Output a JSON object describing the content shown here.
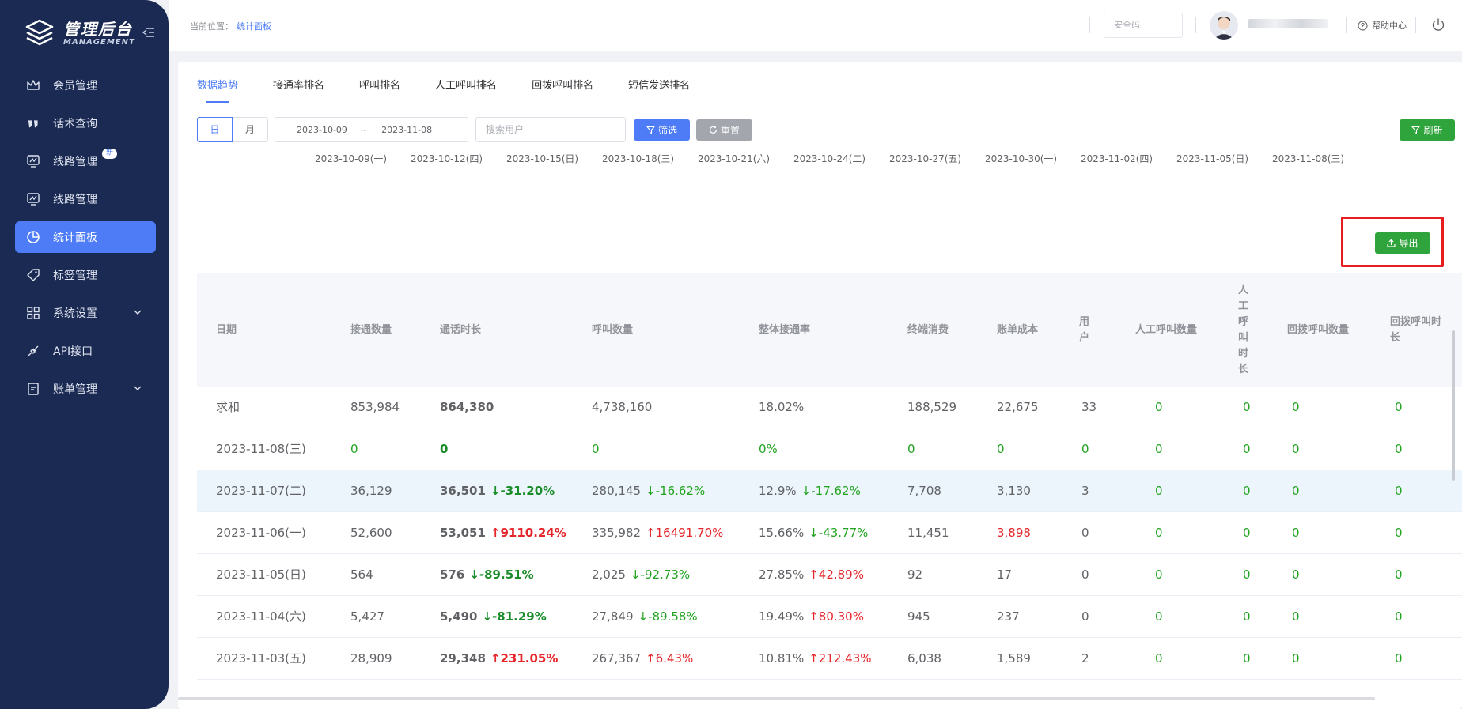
{
  "sidebar": {
    "logo": {
      "title": "管理后台",
      "subtitle": "MANAGEMENT"
    },
    "items": [
      {
        "label": "会员管理",
        "icon": "crown-icon"
      },
      {
        "label": "话术查询",
        "icon": "quote-icon"
      },
      {
        "label": "线路管理",
        "icon": "monitor-icon",
        "badge": "新"
      },
      {
        "label": "线路管理",
        "icon": "monitor-chart-icon"
      },
      {
        "label": "统计面板",
        "icon": "pie-chart-icon",
        "active": true
      },
      {
        "label": "标签管理",
        "icon": "tag-icon"
      },
      {
        "label": "系统设置",
        "icon": "grid-icon",
        "expandable": true
      },
      {
        "label": "API接口",
        "icon": "plug-icon"
      },
      {
        "label": "账单管理",
        "icon": "bill-icon",
        "expandable": true
      }
    ]
  },
  "header": {
    "breadcrumb_prefix": "当前位置：",
    "breadcrumb_current": "统计面板",
    "security_placeholder": "安全码",
    "help_label": "帮助中心"
  },
  "tabs": [
    {
      "label": "数据趋势",
      "active": true
    },
    {
      "label": "接通率排名"
    },
    {
      "label": "呼叫排名"
    },
    {
      "label": "人工呼叫排名"
    },
    {
      "label": "回拨呼叫排名"
    },
    {
      "label": "短信发送排名"
    }
  ],
  "toolbar": {
    "day_label": "日",
    "month_label": "月",
    "date_start": "2023-10-09",
    "date_sep": "~",
    "date_end": "2023-11-08",
    "search_placeholder": "搜索用户",
    "filter_label": "筛选",
    "reset_label": "重置",
    "refresh_label": "刷新"
  },
  "x_axis_labels": [
    "2023-10-09(一)",
    "2023-10-12(四)",
    "2023-10-15(日)",
    "2023-10-18(三)",
    "2023-10-21(六)",
    "2023-10-24(二)",
    "2023-10-27(五)",
    "2023-10-30(一)",
    "2023-11-02(四)",
    "2023-11-05(日)",
    "2023-11-08(三)"
  ],
  "export_label": "导出",
  "table": {
    "headers": [
      "日期",
      "接通数量",
      "通话时长",
      "呼叫数量",
      "整体接通率",
      "终端消费",
      "账单成本",
      "用户",
      "人工呼叫数量",
      "人工呼叫时长",
      "回拨呼叫数量",
      "回拨呼叫时长"
    ],
    "rows": [
      {
        "date": "求和",
        "connected": "853,984",
        "duration": "864,380",
        "duration_chg": "",
        "duration_dir": "",
        "calls": "4,738,160",
        "calls_chg": "",
        "calls_dir": "",
        "rate": "18.02%",
        "rate_chg": "",
        "rate_dir": "",
        "terminal": "188,529",
        "cost": "22,675",
        "cost_red": false,
        "users": "33",
        "manual_calls": "0",
        "manual_dur": "0",
        "cb_calls": "0",
        "cb_dur": "0"
      },
      {
        "date": "2023-11-08(三)",
        "connected": "0",
        "duration": "0",
        "duration_chg": "",
        "duration_dir": "",
        "calls": "0",
        "calls_chg": "",
        "calls_dir": "",
        "rate": "0%",
        "rate_chg": "",
        "rate_dir": "",
        "terminal": "0",
        "cost": "0",
        "cost_red": false,
        "users": "0",
        "manual_calls": "0",
        "manual_dur": "0",
        "cb_calls": "0",
        "cb_dur": "0",
        "zero": true
      },
      {
        "date": "2023-11-07(二)",
        "connected": "36,129",
        "duration": "36,501",
        "duration_chg": "-31.20%",
        "duration_dir": "down",
        "calls": "280,145",
        "calls_chg": "-16.62%",
        "calls_dir": "down",
        "rate": "12.9%",
        "rate_chg": "-17.62%",
        "rate_dir": "down",
        "terminal": "7,708",
        "cost": "3,130",
        "cost_red": false,
        "users": "3",
        "manual_calls": "0",
        "manual_dur": "0",
        "cb_calls": "0",
        "cb_dur": "0",
        "highlight": true
      },
      {
        "date": "2023-11-06(一)",
        "connected": "52,600",
        "duration": "53,051",
        "duration_chg": "9110.24%",
        "duration_dir": "up",
        "calls": "335,982",
        "calls_chg": "16491.70%",
        "calls_dir": "up",
        "rate": "15.66%",
        "rate_chg": "-43.77%",
        "rate_dir": "down",
        "terminal": "11,451",
        "cost": "3,898",
        "cost_red": true,
        "users": "0",
        "manual_calls": "0",
        "manual_dur": "0",
        "cb_calls": "0",
        "cb_dur": "0"
      },
      {
        "date": "2023-11-05(日)",
        "connected": "564",
        "duration": "576",
        "duration_chg": "-89.51%",
        "duration_dir": "down",
        "calls": "2,025",
        "calls_chg": "-92.73%",
        "calls_dir": "down",
        "rate": "27.85%",
        "rate_chg": "42.89%",
        "rate_dir": "up",
        "terminal": "92",
        "cost": "17",
        "cost_red": false,
        "users": "0",
        "manual_calls": "0",
        "manual_dur": "0",
        "cb_calls": "0",
        "cb_dur": "0"
      },
      {
        "date": "2023-11-04(六)",
        "connected": "5,427",
        "duration": "5,490",
        "duration_chg": "-81.29%",
        "duration_dir": "down",
        "calls": "27,849",
        "calls_chg": "-89.58%",
        "calls_dir": "down",
        "rate": "19.49%",
        "rate_chg": "80.30%",
        "rate_dir": "up",
        "terminal": "945",
        "cost": "237",
        "cost_red": false,
        "users": "0",
        "manual_calls": "0",
        "manual_dur": "0",
        "cb_calls": "0",
        "cb_dur": "0"
      },
      {
        "date": "2023-11-03(五)",
        "connected": "28,909",
        "duration": "29,348",
        "duration_chg": "231.05%",
        "duration_dir": "up",
        "calls": "267,367",
        "calls_chg": "6.43%",
        "calls_dir": "up",
        "rate": "10.81%",
        "rate_chg": "212.43%",
        "rate_dir": "up",
        "terminal": "6,038",
        "cost": "1,589",
        "cost_red": false,
        "users": "2",
        "manual_calls": "0",
        "manual_dur": "0",
        "cb_calls": "0",
        "cb_dur": "0"
      }
    ]
  },
  "colors": {
    "primary": "#4e7cf6",
    "sidebar": "#1b2a52",
    "green": "#2fa33c",
    "up": "#e5252a",
    "down": "#1a8c2a",
    "highlight_frame": "#e81c1c"
  }
}
